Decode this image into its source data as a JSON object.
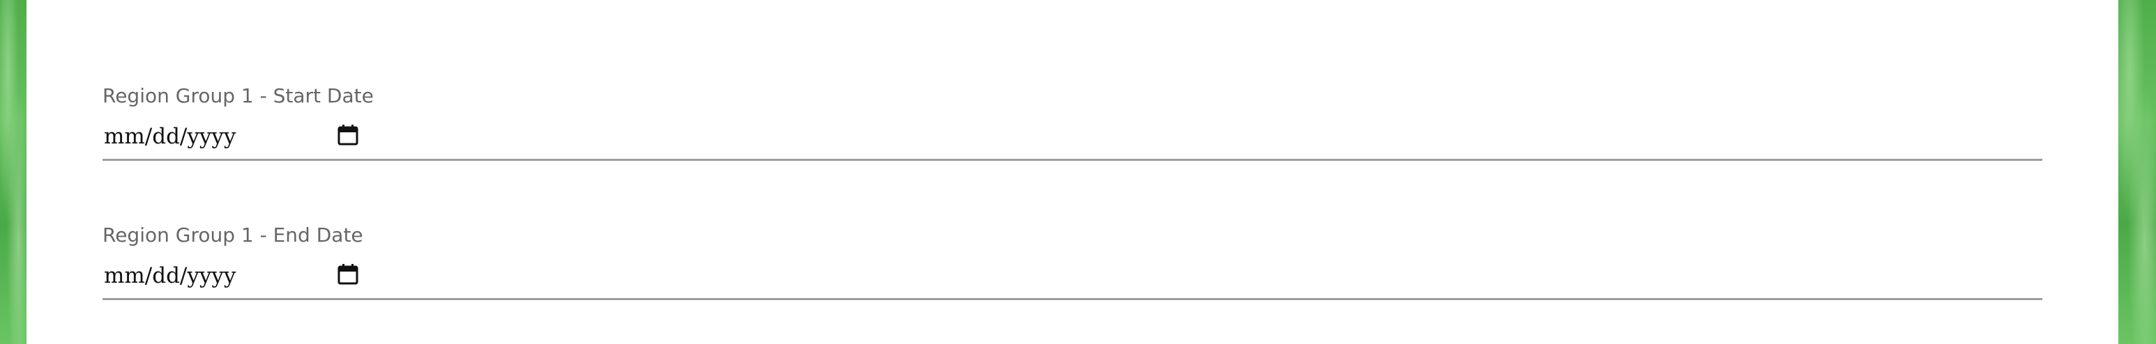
{
  "form": {
    "fields": [
      {
        "label": "Region Group 1 - Start Date",
        "placeholder": "mm/dd/yyyy",
        "icon": "calendar-icon"
      },
      {
        "label": "Region Group 1 - End Date",
        "placeholder": "mm/dd/yyyy",
        "icon": "calendar-icon"
      }
    ]
  },
  "colors": {
    "background_green": "#5cb85c",
    "panel_background": "#ffffff",
    "label_text": "#666666",
    "input_text": "#111111",
    "underline": "#9e9e9e"
  }
}
